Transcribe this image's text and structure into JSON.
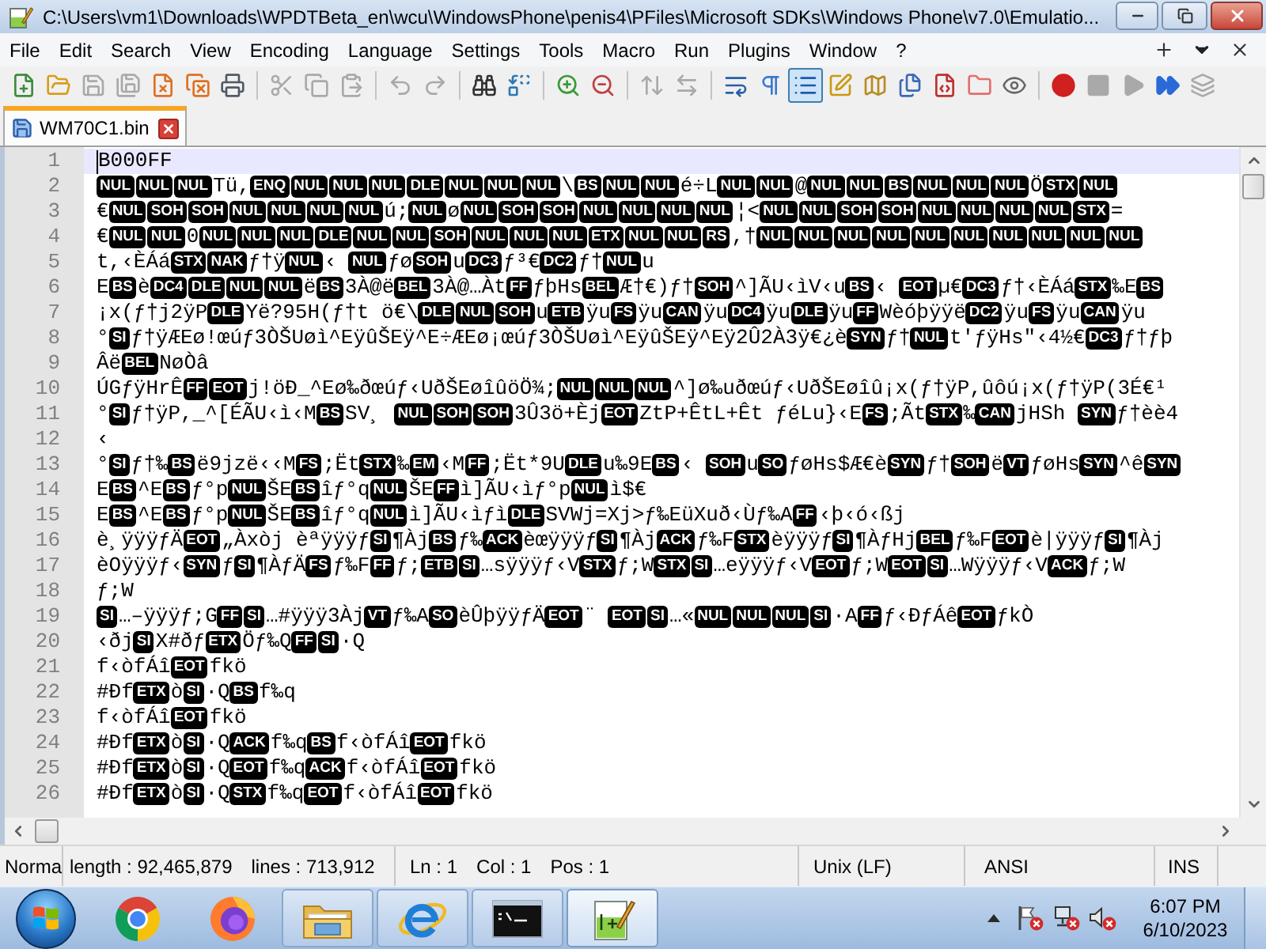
{
  "window": {
    "title": "C:\\Users\\vm1\\Downloads\\WPDTBeta_en\\wcu\\WindowsPhone\\penis4\\PFiles\\Microsoft SDKs\\Windows Phone\\v7.0\\Emulatio..."
  },
  "menu_bar": {
    "items": [
      "File",
      "Edit",
      "Search",
      "View",
      "Encoding",
      "Language",
      "Settings",
      "Tools",
      "Macro",
      "Run",
      "Plugins",
      "Window",
      "?"
    ]
  },
  "toolbar": {
    "groups": [
      [
        {
          "kind": "new",
          "pressed": false,
          "disabled": false
        },
        {
          "kind": "open",
          "pressed": false,
          "disabled": false
        },
        {
          "kind": "save",
          "pressed": false,
          "disabled": true
        },
        {
          "kind": "saveall",
          "pressed": false,
          "disabled": true
        },
        {
          "kind": "close",
          "pressed": false,
          "disabled": false
        },
        {
          "kind": "closeall",
          "pressed": false,
          "disabled": false
        },
        {
          "kind": "print",
          "pressed": false,
          "disabled": false
        }
      ],
      [
        {
          "kind": "cut",
          "pressed": false,
          "disabled": true
        },
        {
          "kind": "copy",
          "pressed": false,
          "disabled": true
        },
        {
          "kind": "paste",
          "pressed": false,
          "disabled": true
        }
      ],
      [
        {
          "kind": "undo",
          "pressed": false,
          "disabled": true
        },
        {
          "kind": "redo",
          "pressed": false,
          "disabled": true
        }
      ],
      [
        {
          "kind": "find",
          "pressed": false,
          "disabled": false
        },
        {
          "kind": "replace",
          "pressed": false,
          "disabled": false
        }
      ],
      [
        {
          "kind": "zoomin",
          "pressed": false,
          "disabled": false
        },
        {
          "kind": "zoomout",
          "pressed": false,
          "disabled": false
        }
      ],
      [
        {
          "kind": "syncv",
          "pressed": false,
          "disabled": true
        },
        {
          "kind": "synch",
          "pressed": false,
          "disabled": true
        }
      ],
      [
        {
          "kind": "wrap",
          "pressed": false,
          "disabled": false
        },
        {
          "kind": "allchars",
          "pressed": false,
          "disabled": false
        },
        {
          "kind": "indent",
          "pressed": true,
          "disabled": false
        },
        {
          "kind": "udl",
          "pressed": false,
          "disabled": false
        },
        {
          "kind": "docmap",
          "pressed": false,
          "disabled": false
        },
        {
          "kind": "doclist",
          "pressed": false,
          "disabled": false
        },
        {
          "kind": "functions",
          "pressed": false,
          "disabled": false
        },
        {
          "kind": "workspace",
          "pressed": false,
          "disabled": false
        },
        {
          "kind": "monitor",
          "pressed": false,
          "disabled": false
        }
      ],
      [
        {
          "kind": "record",
          "pressed": false,
          "disabled": false
        },
        {
          "kind": "stop",
          "pressed": false,
          "disabled": true
        },
        {
          "kind": "play",
          "pressed": false,
          "disabled": true
        },
        {
          "kind": "playmulti",
          "pressed": false,
          "disabled": false
        },
        {
          "kind": "savemacro",
          "pressed": false,
          "disabled": true
        }
      ]
    ]
  },
  "tabs": [
    {
      "label": "WM70C1.bin",
      "selected": true
    }
  ],
  "editor": {
    "lines": [
      {
        "number": "1",
        "current": true,
        "segments": [
          {
            "kind": "text",
            "text": "B000FF"
          }
        ]
      },
      {
        "number": "2",
        "current": false,
        "segments": [
          {
            "kind": "control",
            "text": "NUL"
          },
          {
            "kind": "control",
            "text": "NUL"
          },
          {
            "kind": "control",
            "text": "NUL"
          },
          {
            "kind": "text",
            "text": "Tü,"
          },
          {
            "kind": "control",
            "text": "ENQ"
          },
          {
            "kind": "control",
            "text": "NUL"
          },
          {
            "kind": "control",
            "text": "NUL"
          },
          {
            "kind": "control",
            "text": "NUL"
          },
          {
            "kind": "control",
            "text": "DLE"
          },
          {
            "kind": "control",
            "text": "NUL"
          },
          {
            "kind": "control",
            "text": "NUL"
          },
          {
            "kind": "control",
            "text": "NUL"
          },
          {
            "kind": "text",
            "text": "\\"
          },
          {
            "kind": "control",
            "text": "BS"
          },
          {
            "kind": "control",
            "text": "NUL"
          },
          {
            "kind": "control",
            "text": "NUL"
          },
          {
            "kind": "text",
            "text": "é÷L"
          },
          {
            "kind": "control",
            "text": "NUL"
          },
          {
            "kind": "control",
            "text": "NUL"
          },
          {
            "kind": "text",
            "text": "@"
          },
          {
            "kind": "control",
            "text": "NUL"
          },
          {
            "kind": "control",
            "text": "NUL"
          },
          {
            "kind": "control",
            "text": "BS"
          },
          {
            "kind": "control",
            "text": "NUL"
          },
          {
            "kind": "control",
            "text": "NUL"
          },
          {
            "kind": "control",
            "text": "NUL"
          },
          {
            "kind": "text",
            "text": "Ö"
          },
          {
            "kind": "control",
            "text": "STX"
          },
          {
            "kind": "control",
            "text": "NUL"
          }
        ]
      },
      {
        "number": "3",
        "current": false,
        "segments": [
          {
            "kind": "text",
            "text": "€"
          },
          {
            "kind": "control",
            "text": "NUL"
          },
          {
            "kind": "control",
            "text": "SOH"
          },
          {
            "kind": "control",
            "text": "SOH"
          },
          {
            "kind": "control",
            "text": "NUL"
          },
          {
            "kind": "control",
            "text": "NUL"
          },
          {
            "kind": "control",
            "text": "NUL"
          },
          {
            "kind": "control",
            "text": "NUL"
          },
          {
            "kind": "text",
            "text": "ú;"
          },
          {
            "kind": "control",
            "text": "NUL"
          },
          {
            "kind": "text",
            "text": "ø"
          },
          {
            "kind": "control",
            "text": "NUL"
          },
          {
            "kind": "control",
            "text": "SOH"
          },
          {
            "kind": "control",
            "text": "SOH"
          },
          {
            "kind": "control",
            "text": "NUL"
          },
          {
            "kind": "control",
            "text": "NUL"
          },
          {
            "kind": "control",
            "text": "NUL"
          },
          {
            "kind": "control",
            "text": "NUL"
          },
          {
            "kind": "text",
            "text": "¦<"
          },
          {
            "kind": "control",
            "text": "NUL"
          },
          {
            "kind": "control",
            "text": "NUL"
          },
          {
            "kind": "control",
            "text": "SOH"
          },
          {
            "kind": "control",
            "text": "SOH"
          },
          {
            "kind": "control",
            "text": "NUL"
          },
          {
            "kind": "control",
            "text": "NUL"
          },
          {
            "kind": "control",
            "text": "NUL"
          },
          {
            "kind": "control",
            "text": "NUL"
          },
          {
            "kind": "control",
            "text": "STX"
          },
          {
            "kind": "text",
            "text": "="
          }
        ]
      },
      {
        "number": "4",
        "current": false,
        "segments": [
          {
            "kind": "text",
            "text": "€"
          },
          {
            "kind": "control",
            "text": "NUL"
          },
          {
            "kind": "control",
            "text": "NUL"
          },
          {
            "kind": "text",
            "text": "0"
          },
          {
            "kind": "control",
            "text": "NUL"
          },
          {
            "kind": "control",
            "text": "NUL"
          },
          {
            "kind": "control",
            "text": "NUL"
          },
          {
            "kind": "control",
            "text": "DLE"
          },
          {
            "kind": "control",
            "text": "NUL"
          },
          {
            "kind": "control",
            "text": "NUL"
          },
          {
            "kind": "control",
            "text": "SOH"
          },
          {
            "kind": "control",
            "text": "NUL"
          },
          {
            "kind": "control",
            "text": "NUL"
          },
          {
            "kind": "control",
            "text": "NUL"
          },
          {
            "kind": "control",
            "text": "ETX"
          },
          {
            "kind": "control",
            "text": "NUL"
          },
          {
            "kind": "control",
            "text": "NUL"
          },
          {
            "kind": "control",
            "text": "RS"
          },
          {
            "kind": "text",
            "text": ",†"
          },
          {
            "kind": "control",
            "text": "NUL"
          },
          {
            "kind": "control",
            "text": "NUL"
          },
          {
            "kind": "control",
            "text": "NUL"
          },
          {
            "kind": "control",
            "text": "NUL"
          },
          {
            "kind": "control",
            "text": "NUL"
          },
          {
            "kind": "control",
            "text": "NUL"
          },
          {
            "kind": "control",
            "text": "NUL"
          },
          {
            "kind": "control",
            "text": "NUL"
          },
          {
            "kind": "control",
            "text": "NUL"
          },
          {
            "kind": "control",
            "text": "NUL"
          }
        ]
      },
      {
        "number": "5",
        "current": false,
        "segments": [
          {
            "kind": "text",
            "text": "t,‹ÈÁá"
          },
          {
            "kind": "control",
            "text": "STX"
          },
          {
            "kind": "control",
            "text": "NAK"
          },
          {
            "kind": "text",
            "text": "ƒ†ÿ"
          },
          {
            "kind": "control",
            "text": "NUL"
          },
          {
            "kind": "text",
            "text": "‹ "
          },
          {
            "kind": "control",
            "text": "NUL"
          },
          {
            "kind": "text",
            "text": "ƒø"
          },
          {
            "kind": "control",
            "text": "SOH"
          },
          {
            "kind": "text",
            "text": "u"
          },
          {
            "kind": "control",
            "text": "DC3"
          },
          {
            "kind": "text",
            "text": "ƒ³€"
          },
          {
            "kind": "control",
            "text": "DC2"
          },
          {
            "kind": "text",
            "text": "ƒ†"
          },
          {
            "kind": "control",
            "text": "NUL"
          },
          {
            "kind": "text",
            "text": "u"
          }
        ]
      },
      {
        "number": "6",
        "current": false,
        "segments": [
          {
            "kind": "text",
            "text": "E"
          },
          {
            "kind": "control",
            "text": "BS"
          },
          {
            "kind": "text",
            "text": "è"
          },
          {
            "kind": "control",
            "text": "DC4"
          },
          {
            "kind": "control",
            "text": "DLE"
          },
          {
            "kind": "control",
            "text": "NUL"
          },
          {
            "kind": "control",
            "text": "NUL"
          },
          {
            "kind": "text",
            "text": "ë"
          },
          {
            "kind": "control",
            "text": "BS"
          },
          {
            "kind": "text",
            "text": "3À@ë"
          },
          {
            "kind": "control",
            "text": "BEL"
          },
          {
            "kind": "text",
            "text": "3À@…Àt"
          },
          {
            "kind": "control",
            "text": "FF"
          },
          {
            "kind": "text",
            "text": "ƒþHs"
          },
          {
            "kind": "control",
            "text": "BEL"
          },
          {
            "kind": "text",
            "text": "Æ†€)ƒ†"
          },
          {
            "kind": "control",
            "text": "SOH"
          },
          {
            "kind": "text",
            "text": "^]ÃU‹ìV‹u"
          },
          {
            "kind": "control",
            "text": "BS"
          },
          {
            "kind": "text",
            "text": "‹ "
          },
          {
            "kind": "control",
            "text": "EOT"
          },
          {
            "kind": "text",
            "text": "µ€"
          },
          {
            "kind": "control",
            "text": "DC3"
          },
          {
            "kind": "text",
            "text": "ƒ†‹ÈÁá"
          },
          {
            "kind": "control",
            "text": "STX"
          },
          {
            "kind": "text",
            "text": "‰E"
          },
          {
            "kind": "control",
            "text": "BS"
          }
        ]
      },
      {
        "number": "7",
        "current": false,
        "segments": [
          {
            "kind": "text",
            "text": "¡x(ƒ†j2ÿP"
          },
          {
            "kind": "control",
            "text": "DLE"
          },
          {
            "kind": "text",
            "text": "Yë?95H(ƒ†t ö€\\"
          },
          {
            "kind": "control",
            "text": "DLE"
          },
          {
            "kind": "control",
            "text": "NUL"
          },
          {
            "kind": "control",
            "text": "SOH"
          },
          {
            "kind": "text",
            "text": "u"
          },
          {
            "kind": "control",
            "text": "ETB"
          },
          {
            "kind": "text",
            "text": "ÿu"
          },
          {
            "kind": "control",
            "text": "FS"
          },
          {
            "kind": "text",
            "text": "ÿu"
          },
          {
            "kind": "control",
            "text": "CAN"
          },
          {
            "kind": "text",
            "text": "ÿu"
          },
          {
            "kind": "control",
            "text": "DC4"
          },
          {
            "kind": "text",
            "text": "ÿu"
          },
          {
            "kind": "control",
            "text": "DLE"
          },
          {
            "kind": "text",
            "text": "ÿu"
          },
          {
            "kind": "control",
            "text": "FF"
          },
          {
            "kind": "text",
            "text": "Wèóþÿÿë"
          },
          {
            "kind": "control",
            "text": "DC2"
          },
          {
            "kind": "text",
            "text": "ÿu"
          },
          {
            "kind": "control",
            "text": "FS"
          },
          {
            "kind": "text",
            "text": "ÿu"
          },
          {
            "kind": "control",
            "text": "CAN"
          },
          {
            "kind": "text",
            "text": "ÿu"
          }
        ]
      },
      {
        "number": "8",
        "current": false,
        "segments": [
          {
            "kind": "text",
            "text": "°"
          },
          {
            "kind": "control",
            "text": "SI"
          },
          {
            "kind": "text",
            "text": "ƒ†ÿÆEø!œúƒ3ÒŠUøì^EÿûŠEÿ^E÷ÆEø¡œúƒ3ÒŠUøì^EÿûŠEÿ^Eÿ2Û2À3ÿ€¿è"
          },
          {
            "kind": "control",
            "text": "SYN"
          },
          {
            "kind": "text",
            "text": "ƒ†"
          },
          {
            "kind": "control",
            "text": "NUL"
          },
          {
            "kind": "text",
            "text": "t'ƒÿHs\"‹4½€"
          },
          {
            "kind": "control",
            "text": "DC3"
          },
          {
            "kind": "text",
            "text": "ƒ†ƒþ"
          }
        ]
      },
      {
        "number": "9",
        "current": false,
        "segments": [
          {
            "kind": "text",
            "text": "Âë"
          },
          {
            "kind": "control",
            "text": "BEL"
          },
          {
            "kind": "text",
            "text": "NøÒâ"
          }
        ]
      },
      {
        "number": "10",
        "current": false,
        "segments": [
          {
            "kind": "text",
            "text": "ÚGƒÿHrÊ"
          },
          {
            "kind": "control",
            "text": "FF"
          },
          {
            "kind": "control",
            "text": "EOT"
          },
          {
            "kind": "text",
            "text": "j!öÐ_^Eø‰ðœúƒ‹UðŠEøîûöÖ¾;"
          },
          {
            "kind": "control",
            "text": "NUL"
          },
          {
            "kind": "control",
            "text": "NUL"
          },
          {
            "kind": "control",
            "text": "NUL"
          },
          {
            "kind": "text",
            "text": "^]ø‰uðœúƒ‹UðŠEøîû¡x(ƒ†ÿP,ûôú¡x(ƒ†ÿP(3É€¹"
          }
        ]
      },
      {
        "number": "11",
        "current": false,
        "segments": [
          {
            "kind": "text",
            "text": "°"
          },
          {
            "kind": "control",
            "text": "SI"
          },
          {
            "kind": "text",
            "text": "ƒ†ÿP,_^[ÉÃU‹ì‹M"
          },
          {
            "kind": "control",
            "text": "BS"
          },
          {
            "kind": "text",
            "text": "SV¸ "
          },
          {
            "kind": "control",
            "text": "NUL"
          },
          {
            "kind": "control",
            "text": "SOH"
          },
          {
            "kind": "control",
            "text": "SOH"
          },
          {
            "kind": "text",
            "text": "3Û3ö+Èj"
          },
          {
            "kind": "control",
            "text": "EOT"
          },
          {
            "kind": "text",
            "text": "ZtP+ÊtL+Êt ƒéLu}‹E"
          },
          {
            "kind": "control",
            "text": "FS"
          },
          {
            "kind": "text",
            "text": ";Ãt"
          },
          {
            "kind": "control",
            "text": "STX"
          },
          {
            "kind": "text",
            "text": "‰"
          },
          {
            "kind": "control",
            "text": "CAN"
          },
          {
            "kind": "text",
            "text": "jHSh "
          },
          {
            "kind": "control",
            "text": "SYN"
          },
          {
            "kind": "text",
            "text": "ƒ†èè4"
          }
        ]
      },
      {
        "number": "12",
        "current": false,
        "segments": [
          {
            "kind": "text",
            "text": "‹"
          }
        ]
      },
      {
        "number": "13",
        "current": false,
        "segments": [
          {
            "kind": "text",
            "text": "°"
          },
          {
            "kind": "control",
            "text": "SI"
          },
          {
            "kind": "text",
            "text": "ƒ†‰"
          },
          {
            "kind": "control",
            "text": "BS"
          },
          {
            "kind": "text",
            "text": "ë9jzë‹‹M"
          },
          {
            "kind": "control",
            "text": "FS"
          },
          {
            "kind": "text",
            "text": ";Ët"
          },
          {
            "kind": "control",
            "text": "STX"
          },
          {
            "kind": "text",
            "text": "‰"
          },
          {
            "kind": "control",
            "text": "EM"
          },
          {
            "kind": "text",
            "text": "‹M"
          },
          {
            "kind": "control",
            "text": "FF"
          },
          {
            "kind": "text",
            "text": ";Ët*9U"
          },
          {
            "kind": "control",
            "text": "DLE"
          },
          {
            "kind": "text",
            "text": "u‰9E"
          },
          {
            "kind": "control",
            "text": "BS"
          },
          {
            "kind": "text",
            "text": "‹ "
          },
          {
            "kind": "control",
            "text": "SOH"
          },
          {
            "kind": "text",
            "text": "u"
          },
          {
            "kind": "control",
            "text": "SO"
          },
          {
            "kind": "text",
            "text": "ƒøHs$Æ€è"
          },
          {
            "kind": "control",
            "text": "SYN"
          },
          {
            "kind": "text",
            "text": "ƒ†"
          },
          {
            "kind": "control",
            "text": "SOH"
          },
          {
            "kind": "text",
            "text": "ë"
          },
          {
            "kind": "control",
            "text": "VT"
          },
          {
            "kind": "text",
            "text": "ƒøHs"
          },
          {
            "kind": "control",
            "text": "SYN"
          },
          {
            "kind": "text",
            "text": "^ê"
          },
          {
            "kind": "control",
            "text": "SYN"
          }
        ]
      },
      {
        "number": "14",
        "current": false,
        "segments": [
          {
            "kind": "text",
            "text": "E"
          },
          {
            "kind": "control",
            "text": "BS"
          },
          {
            "kind": "text",
            "text": "^E"
          },
          {
            "kind": "control",
            "text": "BS"
          },
          {
            "kind": "text",
            "text": "ƒ°p"
          },
          {
            "kind": "control",
            "text": "NUL"
          },
          {
            "kind": "text",
            "text": "ŠE"
          },
          {
            "kind": "control",
            "text": "BS"
          },
          {
            "kind": "text",
            "text": "îƒ°q"
          },
          {
            "kind": "control",
            "text": "NUL"
          },
          {
            "kind": "text",
            "text": "ŠE"
          },
          {
            "kind": "control",
            "text": "FF"
          },
          {
            "kind": "text",
            "text": "ì]ÃU‹ìƒ°p"
          },
          {
            "kind": "control",
            "text": "NUL"
          },
          {
            "kind": "text",
            "text": "ì$€"
          }
        ]
      },
      {
        "number": "15",
        "current": false,
        "segments": [
          {
            "kind": "text",
            "text": "E"
          },
          {
            "kind": "control",
            "text": "BS"
          },
          {
            "kind": "text",
            "text": "^E"
          },
          {
            "kind": "control",
            "text": "BS"
          },
          {
            "kind": "text",
            "text": "ƒ°p"
          },
          {
            "kind": "control",
            "text": "NUL"
          },
          {
            "kind": "text",
            "text": "ŠE"
          },
          {
            "kind": "control",
            "text": "BS"
          },
          {
            "kind": "text",
            "text": "îƒ°q"
          },
          {
            "kind": "control",
            "text": "NUL"
          },
          {
            "kind": "text",
            "text": "ì]ÃU‹ìƒì"
          },
          {
            "kind": "control",
            "text": "DLE"
          },
          {
            "kind": "text",
            "text": "SVWj=Xj>ƒ‰EüXuð‹Ùƒ‰A"
          },
          {
            "kind": "control",
            "text": "FF"
          },
          {
            "kind": "text",
            "text": "‹þ‹ó‹ßj"
          }
        ]
      },
      {
        "number": "16",
        "current": false,
        "segments": [
          {
            "kind": "text",
            "text": "è¸ÿÿÿƒÄ"
          },
          {
            "kind": "control",
            "text": "EOT"
          },
          {
            "kind": "text",
            "text": "„Àxòj èªÿÿÿƒ"
          },
          {
            "kind": "control",
            "text": "SI"
          },
          {
            "kind": "text",
            "text": "¶Àj"
          },
          {
            "kind": "control",
            "text": "BS"
          },
          {
            "kind": "text",
            "text": "ƒ‰"
          },
          {
            "kind": "control",
            "text": "ACK"
          },
          {
            "kind": "text",
            "text": "èœÿÿÿƒ"
          },
          {
            "kind": "control",
            "text": "SI"
          },
          {
            "kind": "text",
            "text": "¶Àj"
          },
          {
            "kind": "control",
            "text": "ACK"
          },
          {
            "kind": "text",
            "text": "ƒ‰F"
          },
          {
            "kind": "control",
            "text": "STX"
          },
          {
            "kind": "text",
            "text": "èÿÿÿƒ"
          },
          {
            "kind": "control",
            "text": "SI"
          },
          {
            "kind": "text",
            "text": "¶ÀƒHj"
          },
          {
            "kind": "control",
            "text": "BEL"
          },
          {
            "kind": "text",
            "text": "ƒ‰F"
          },
          {
            "kind": "control",
            "text": "EOT"
          },
          {
            "kind": "text",
            "text": "è|ÿÿÿƒ"
          },
          {
            "kind": "control",
            "text": "SI"
          },
          {
            "kind": "text",
            "text": "¶Àj"
          }
        ]
      },
      {
        "number": "17",
        "current": false,
        "segments": [
          {
            "kind": "text",
            "text": "èOÿÿÿƒ‹"
          },
          {
            "kind": "control",
            "text": "SYN"
          },
          {
            "kind": "text",
            "text": "ƒ"
          },
          {
            "kind": "control",
            "text": "SI"
          },
          {
            "kind": "text",
            "text": "¶ÀƒÄ"
          },
          {
            "kind": "control",
            "text": "FS"
          },
          {
            "kind": "text",
            "text": "ƒ‰F"
          },
          {
            "kind": "control",
            "text": "FF"
          },
          {
            "kind": "text",
            "text": "ƒ;"
          },
          {
            "kind": "control",
            "text": "ETB"
          },
          {
            "kind": "control",
            "text": "SI"
          },
          {
            "kind": "text",
            "text": "…sÿÿÿƒ‹V"
          },
          {
            "kind": "control",
            "text": "STX"
          },
          {
            "kind": "text",
            "text": "ƒ;W"
          },
          {
            "kind": "control",
            "text": "STX"
          },
          {
            "kind": "control",
            "text": "SI"
          },
          {
            "kind": "text",
            "text": "…eÿÿÿƒ‹V"
          },
          {
            "kind": "control",
            "text": "EOT"
          },
          {
            "kind": "text",
            "text": "ƒ;W"
          },
          {
            "kind": "control",
            "text": "EOT"
          },
          {
            "kind": "control",
            "text": "SI"
          },
          {
            "kind": "text",
            "text": "…Wÿÿÿƒ‹V"
          },
          {
            "kind": "control",
            "text": "ACK"
          },
          {
            "kind": "text",
            "text": "ƒ;W"
          }
        ]
      },
      {
        "number": "18",
        "current": false,
        "segments": [
          {
            "kind": "text",
            "text": "ƒ;W"
          }
        ]
      },
      {
        "number": "19",
        "current": false,
        "segments": [
          {
            "kind": "control",
            "text": "SI"
          },
          {
            "kind": "text",
            "text": "…–ÿÿÿƒ;G"
          },
          {
            "kind": "control",
            "text": "FF"
          },
          {
            "kind": "control",
            "text": "SI"
          },
          {
            "kind": "text",
            "text": "…#ÿÿÿ3Àj"
          },
          {
            "kind": "control",
            "text": "VT"
          },
          {
            "kind": "text",
            "text": "ƒ‰A"
          },
          {
            "kind": "control",
            "text": "SO"
          },
          {
            "kind": "text",
            "text": "èÛþÿÿƒÄ"
          },
          {
            "kind": "control",
            "text": "EOT"
          },
          {
            "kind": "text",
            "text": "¨ "
          },
          {
            "kind": "control",
            "text": "EOT"
          },
          {
            "kind": "control",
            "text": "SI"
          },
          {
            "kind": "text",
            "text": "…«"
          },
          {
            "kind": "control",
            "text": "NUL"
          },
          {
            "kind": "control",
            "text": "NUL"
          },
          {
            "kind": "control",
            "text": "NUL"
          },
          {
            "kind": "control",
            "text": "SI"
          },
          {
            "kind": "text",
            "text": "·A"
          },
          {
            "kind": "control",
            "text": "FF"
          },
          {
            "kind": "text",
            "text": "ƒ‹ÐƒÁê"
          },
          {
            "kind": "control",
            "text": "EOT"
          },
          {
            "kind": "text",
            "text": "ƒkÒ"
          }
        ]
      },
      {
        "number": "20",
        "current": false,
        "segments": [
          {
            "kind": "text",
            "text": "‹ðj"
          },
          {
            "kind": "control",
            "text": "SI"
          },
          {
            "kind": "text",
            "text": "X#ðƒ"
          },
          {
            "kind": "control",
            "text": "ETX"
          },
          {
            "kind": "text",
            "text": "Öƒ‰Q"
          },
          {
            "kind": "control",
            "text": "FF"
          },
          {
            "kind": "control",
            "text": "SI"
          },
          {
            "kind": "text",
            "text": "·Q"
          }
        ]
      },
      {
        "number": "21",
        "current": false,
        "segments": [
          {
            "kind": "text",
            "text": "f‹òfÁî"
          },
          {
            "kind": "control",
            "text": "EOT"
          },
          {
            "kind": "text",
            "text": "fkö"
          }
        ]
      },
      {
        "number": "22",
        "current": false,
        "segments": [
          {
            "kind": "text",
            "text": "#Ðf"
          },
          {
            "kind": "control",
            "text": "ETX"
          },
          {
            "kind": "text",
            "text": "ò"
          },
          {
            "kind": "control",
            "text": "SI"
          },
          {
            "kind": "text",
            "text": "·Q"
          },
          {
            "kind": "control",
            "text": "BS"
          },
          {
            "kind": "text",
            "text": "f‰q"
          }
        ]
      },
      {
        "number": "23",
        "current": false,
        "segments": [
          {
            "kind": "text",
            "text": "f‹òfÁî"
          },
          {
            "kind": "control",
            "text": "EOT"
          },
          {
            "kind": "text",
            "text": "fkö"
          }
        ]
      },
      {
        "number": "24",
        "current": false,
        "segments": [
          {
            "kind": "text",
            "text": "#Ðf"
          },
          {
            "kind": "control",
            "text": "ETX"
          },
          {
            "kind": "text",
            "text": "ò"
          },
          {
            "kind": "control",
            "text": "SI"
          },
          {
            "kind": "text",
            "text": "·Q"
          },
          {
            "kind": "control",
            "text": "ACK"
          },
          {
            "kind": "text",
            "text": "f‰q"
          },
          {
            "kind": "control",
            "text": "BS"
          },
          {
            "kind": "text",
            "text": "f‹òfÁî"
          },
          {
            "kind": "control",
            "text": "EOT"
          },
          {
            "kind": "text",
            "text": "fkö"
          }
        ]
      },
      {
        "number": "25",
        "current": false,
        "segments": [
          {
            "kind": "text",
            "text": "#Ðf"
          },
          {
            "kind": "control",
            "text": "ETX"
          },
          {
            "kind": "text",
            "text": "ò"
          },
          {
            "kind": "control",
            "text": "SI"
          },
          {
            "kind": "text",
            "text": "·Q"
          },
          {
            "kind": "control",
            "text": "EOT"
          },
          {
            "kind": "text",
            "text": "f‰q"
          },
          {
            "kind": "control",
            "text": "ACK"
          },
          {
            "kind": "text",
            "text": "f‹òfÁî"
          },
          {
            "kind": "control",
            "text": "EOT"
          },
          {
            "kind": "text",
            "text": "fkö"
          }
        ]
      },
      {
        "number": "26",
        "current": false,
        "segments": [
          {
            "kind": "text",
            "text": "#Ðf"
          },
          {
            "kind": "control",
            "text": "ETX"
          },
          {
            "kind": "text",
            "text": "ò"
          },
          {
            "kind": "control",
            "text": "SI"
          },
          {
            "kind": "text",
            "text": "·Q"
          },
          {
            "kind": "control",
            "text": "STX"
          },
          {
            "kind": "text",
            "text": "f‰q"
          },
          {
            "kind": "control",
            "text": "EOT"
          },
          {
            "kind": "text",
            "text": "f‹òfÁî"
          },
          {
            "kind": "control",
            "text": "EOT"
          },
          {
            "kind": "text",
            "text": "fkö"
          }
        ]
      }
    ]
  },
  "status_bar": {
    "document_type": "Norma",
    "length": "length : 92,465,879",
    "lines": "lines : 713,912",
    "line": "Ln : 1",
    "column": "Col : 1",
    "position": "Pos : 1",
    "eol": "Unix (LF)",
    "encoding": "ANSI",
    "mode": "INS"
  },
  "taskbar": {
    "apps": [
      {
        "kind": "chrome",
        "running": false,
        "active": false
      },
      {
        "kind": "firefox",
        "running": false,
        "active": false
      },
      {
        "kind": "explorer",
        "running": true,
        "active": false
      },
      {
        "kind": "ie",
        "running": true,
        "active": false
      },
      {
        "kind": "cmd",
        "running": true,
        "active": false
      },
      {
        "kind": "notepad",
        "running": true,
        "active": true
      }
    ],
    "clock": {
      "time": "6:07 PM",
      "date": "6/10/2023"
    }
  }
}
